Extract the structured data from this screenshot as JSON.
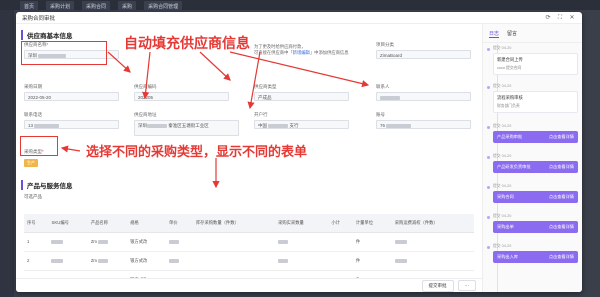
{
  "background": {
    "tabs": [
      "首页",
      "采购计划",
      "采购合同",
      "采购",
      "采购合同管理"
    ]
  },
  "modal": {
    "title": "采购合同审批",
    "supplier_section": "供应商基本信息",
    "supplier_name_label": "供应商名称",
    "supplier_name_value": "深圳",
    "note_line1": "为了更及时给供应商付款，",
    "note_line2": "可直接在供应商中「",
    "note_link": "新增编辑",
    "note_line3": "」中添加供应商信息",
    "project_cat_label": "项目分类",
    "project_cat_value": "ZimaBoard",
    "date_label": "采购日期",
    "date_value": "2022-05-20",
    "code_label": "供应商编码",
    "code_value": "202205",
    "supplier_type_label": "供应商类型",
    "supplier_type_value": "产成品",
    "contact_label": "联系人",
    "phone_label": "联系电话",
    "phone_value": "13",
    "address_label": "供应商地址",
    "address_value": "深圳",
    "address_value2": "秦淮区五塘街工业区",
    "bank_label": "开户行",
    "bank_value": "中国",
    "bank_value2": "支行",
    "account_label": "账号",
    "account_value": "76",
    "purchase_type_label": "采购类型",
    "purchase_type_value": "生产",
    "product_section": "产品与服务信息",
    "product_sub": "可选产品",
    "table_headers": [
      "序号",
      "SKU编号",
      "产品名称",
      "规格",
      "单价",
      "库存采购数量（件数）",
      "采购实采数量",
      "小计",
      "计量单位",
      "采购运费减权（件数）"
    ],
    "rows": [
      {
        "no": "1",
        "sku": "",
        "name": "Zm",
        "spec": "银方式改",
        "price": "",
        "unit": "件"
      },
      {
        "no": "2",
        "sku": "",
        "name": "Zm",
        "spec": "银方式改",
        "price": "",
        "unit": "件"
      },
      {
        "no": "3",
        "sku": "",
        "name": "Zm",
        "spec": "银方式改",
        "price": "",
        "unit": "件"
      }
    ],
    "submit_label": "提交审批",
    "more_label": "···"
  },
  "annotations": {
    "auto_fill": "自动填充供应商信息",
    "select_type": "选择不同的采购类型，显示不同的表单"
  },
  "sidebar": {
    "tabs": [
      "日志",
      "留言"
    ],
    "items": [
      {
        "time": "提交 04-20",
        "title": "新建合同上传",
        "who": "coco 提交合同",
        "tag": ""
      },
      {
        "time": "提交 04-20",
        "title": "流程采购审核",
        "who": "财务部门负责",
        "tag": ""
      },
      {
        "time": "提交 04-20",
        "title": "产品采购审批",
        "who": "",
        "tag": "点击查看详情"
      },
      {
        "time": "提交 04-20",
        "title": "产品研发负责审批",
        "who": "",
        "tag": "点击查看详情"
      },
      {
        "time": "提交 04-20",
        "title": "采购合同",
        "who": "",
        "tag": "点击查看详情"
      },
      {
        "time": "提交 04-20",
        "title": "采购出单",
        "who": "",
        "tag": "点击查看详情"
      },
      {
        "time": "提交 04-20",
        "title": "采购出入库",
        "who": "",
        "tag": "点击查看详情"
      }
    ]
  },
  "colors": {
    "annotation": "#e53935",
    "accent": "#6b4fd8",
    "tag": "#f1b64a"
  }
}
